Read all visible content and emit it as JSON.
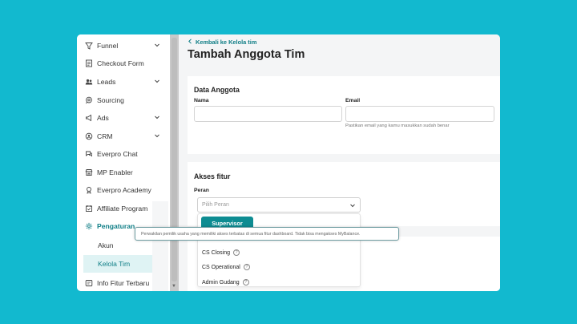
{
  "sidebar": {
    "items": [
      {
        "label": "Funnel",
        "icon": "funnel-icon",
        "chevron": true
      },
      {
        "label": "Checkout Form",
        "icon": "form-icon",
        "chevron": false
      },
      {
        "label": "Leads",
        "icon": "users-icon",
        "chevron": true
      },
      {
        "label": "Sourcing",
        "icon": "search-chat-icon",
        "chevron": false
      },
      {
        "label": "Ads",
        "icon": "megaphone-icon",
        "chevron": true
      },
      {
        "label": "CRM",
        "icon": "crm-icon",
        "chevron": true
      },
      {
        "label": "Everpro Chat",
        "icon": "chat-icon",
        "chevron": false
      },
      {
        "label": "MP Enabler",
        "icon": "store-icon",
        "chevron": false
      },
      {
        "label": "Everpro Academy",
        "icon": "academy-icon",
        "chevron": false
      },
      {
        "label": "Affiliate Program",
        "icon": "affiliate-icon",
        "chevron": false
      },
      {
        "label": "Pengaturan",
        "icon": "gear-icon",
        "chevron": false,
        "active": true
      }
    ],
    "subitems": [
      {
        "label": "Akun"
      },
      {
        "label": "Kelola Tim",
        "selected": true
      }
    ],
    "last_item": {
      "label": "Info Fitur Terbaru",
      "icon": "info-icon"
    }
  },
  "header": {
    "back_label": "Kembali ke Kelola tim",
    "title": "Tambah Anggota Tim"
  },
  "data_anggota": {
    "title": "Data Anggota",
    "name_label": "Nama",
    "name_value": "",
    "email_label": "Email",
    "email_value": "",
    "email_hint": "Pastikan email yang kamu masukkan sudah benar"
  },
  "akses_fitur": {
    "title": "Akses fitur",
    "role_label": "Peran",
    "role_placeholder": "Pilih Peran",
    "options": [
      {
        "label": "Supervisor",
        "highlighted": true
      },
      {
        "label": "CS Closing"
      },
      {
        "label": "CS Operational"
      },
      {
        "label": "Admin Gudang"
      }
    ],
    "help_glyph": "?",
    "tooltip": "Perwakilan pemilik usaha yang memiliki akses terbatas di semua fitur dashboard. Tidak bisa mengakses MyBalance."
  },
  "colors": {
    "background": "#12b9cf",
    "accent": "#0e8c92",
    "accent_text": "#0f7e86",
    "selected_bg": "#dff3f4"
  }
}
